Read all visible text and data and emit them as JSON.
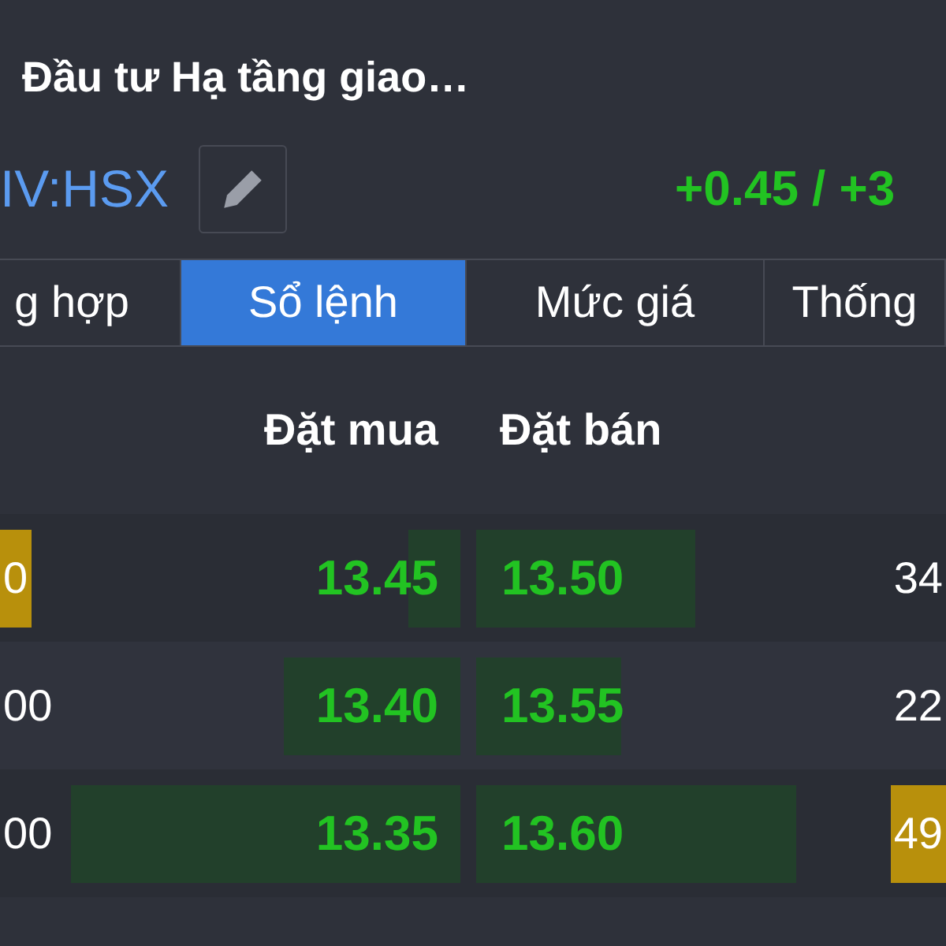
{
  "header": {
    "title": "Đầu tư Hạ tầng giao…",
    "symbol": "IV:HSX",
    "change": "+0.45 / +3"
  },
  "tabs": [
    {
      "label": "g hợp",
      "selected": false
    },
    {
      "label": "Sổ lệnh",
      "selected": true
    },
    {
      "label": "Mức giá",
      "selected": false
    },
    {
      "label": "Thống",
      "selected": false
    }
  ],
  "order_book": {
    "columns": [
      "Đặt mua",
      "Đặt bán"
    ],
    "rows": [
      {
        "bid_volume": "0",
        "bid_volume_highlighted": true,
        "bid": "13.45",
        "ask": "13.50",
        "ask_volume": "34",
        "ask_volume_highlighted": false
      },
      {
        "bid_volume": "00",
        "bid_volume_highlighted": false,
        "bid": "13.40",
        "ask": "13.55",
        "ask_volume": "22",
        "ask_volume_highlighted": false
      },
      {
        "bid_volume": "00",
        "bid_volume_highlighted": false,
        "bid": "13.35",
        "ask": "13.60",
        "ask_volume": "49",
        "ask_volume_highlighted": true
      }
    ]
  }
}
